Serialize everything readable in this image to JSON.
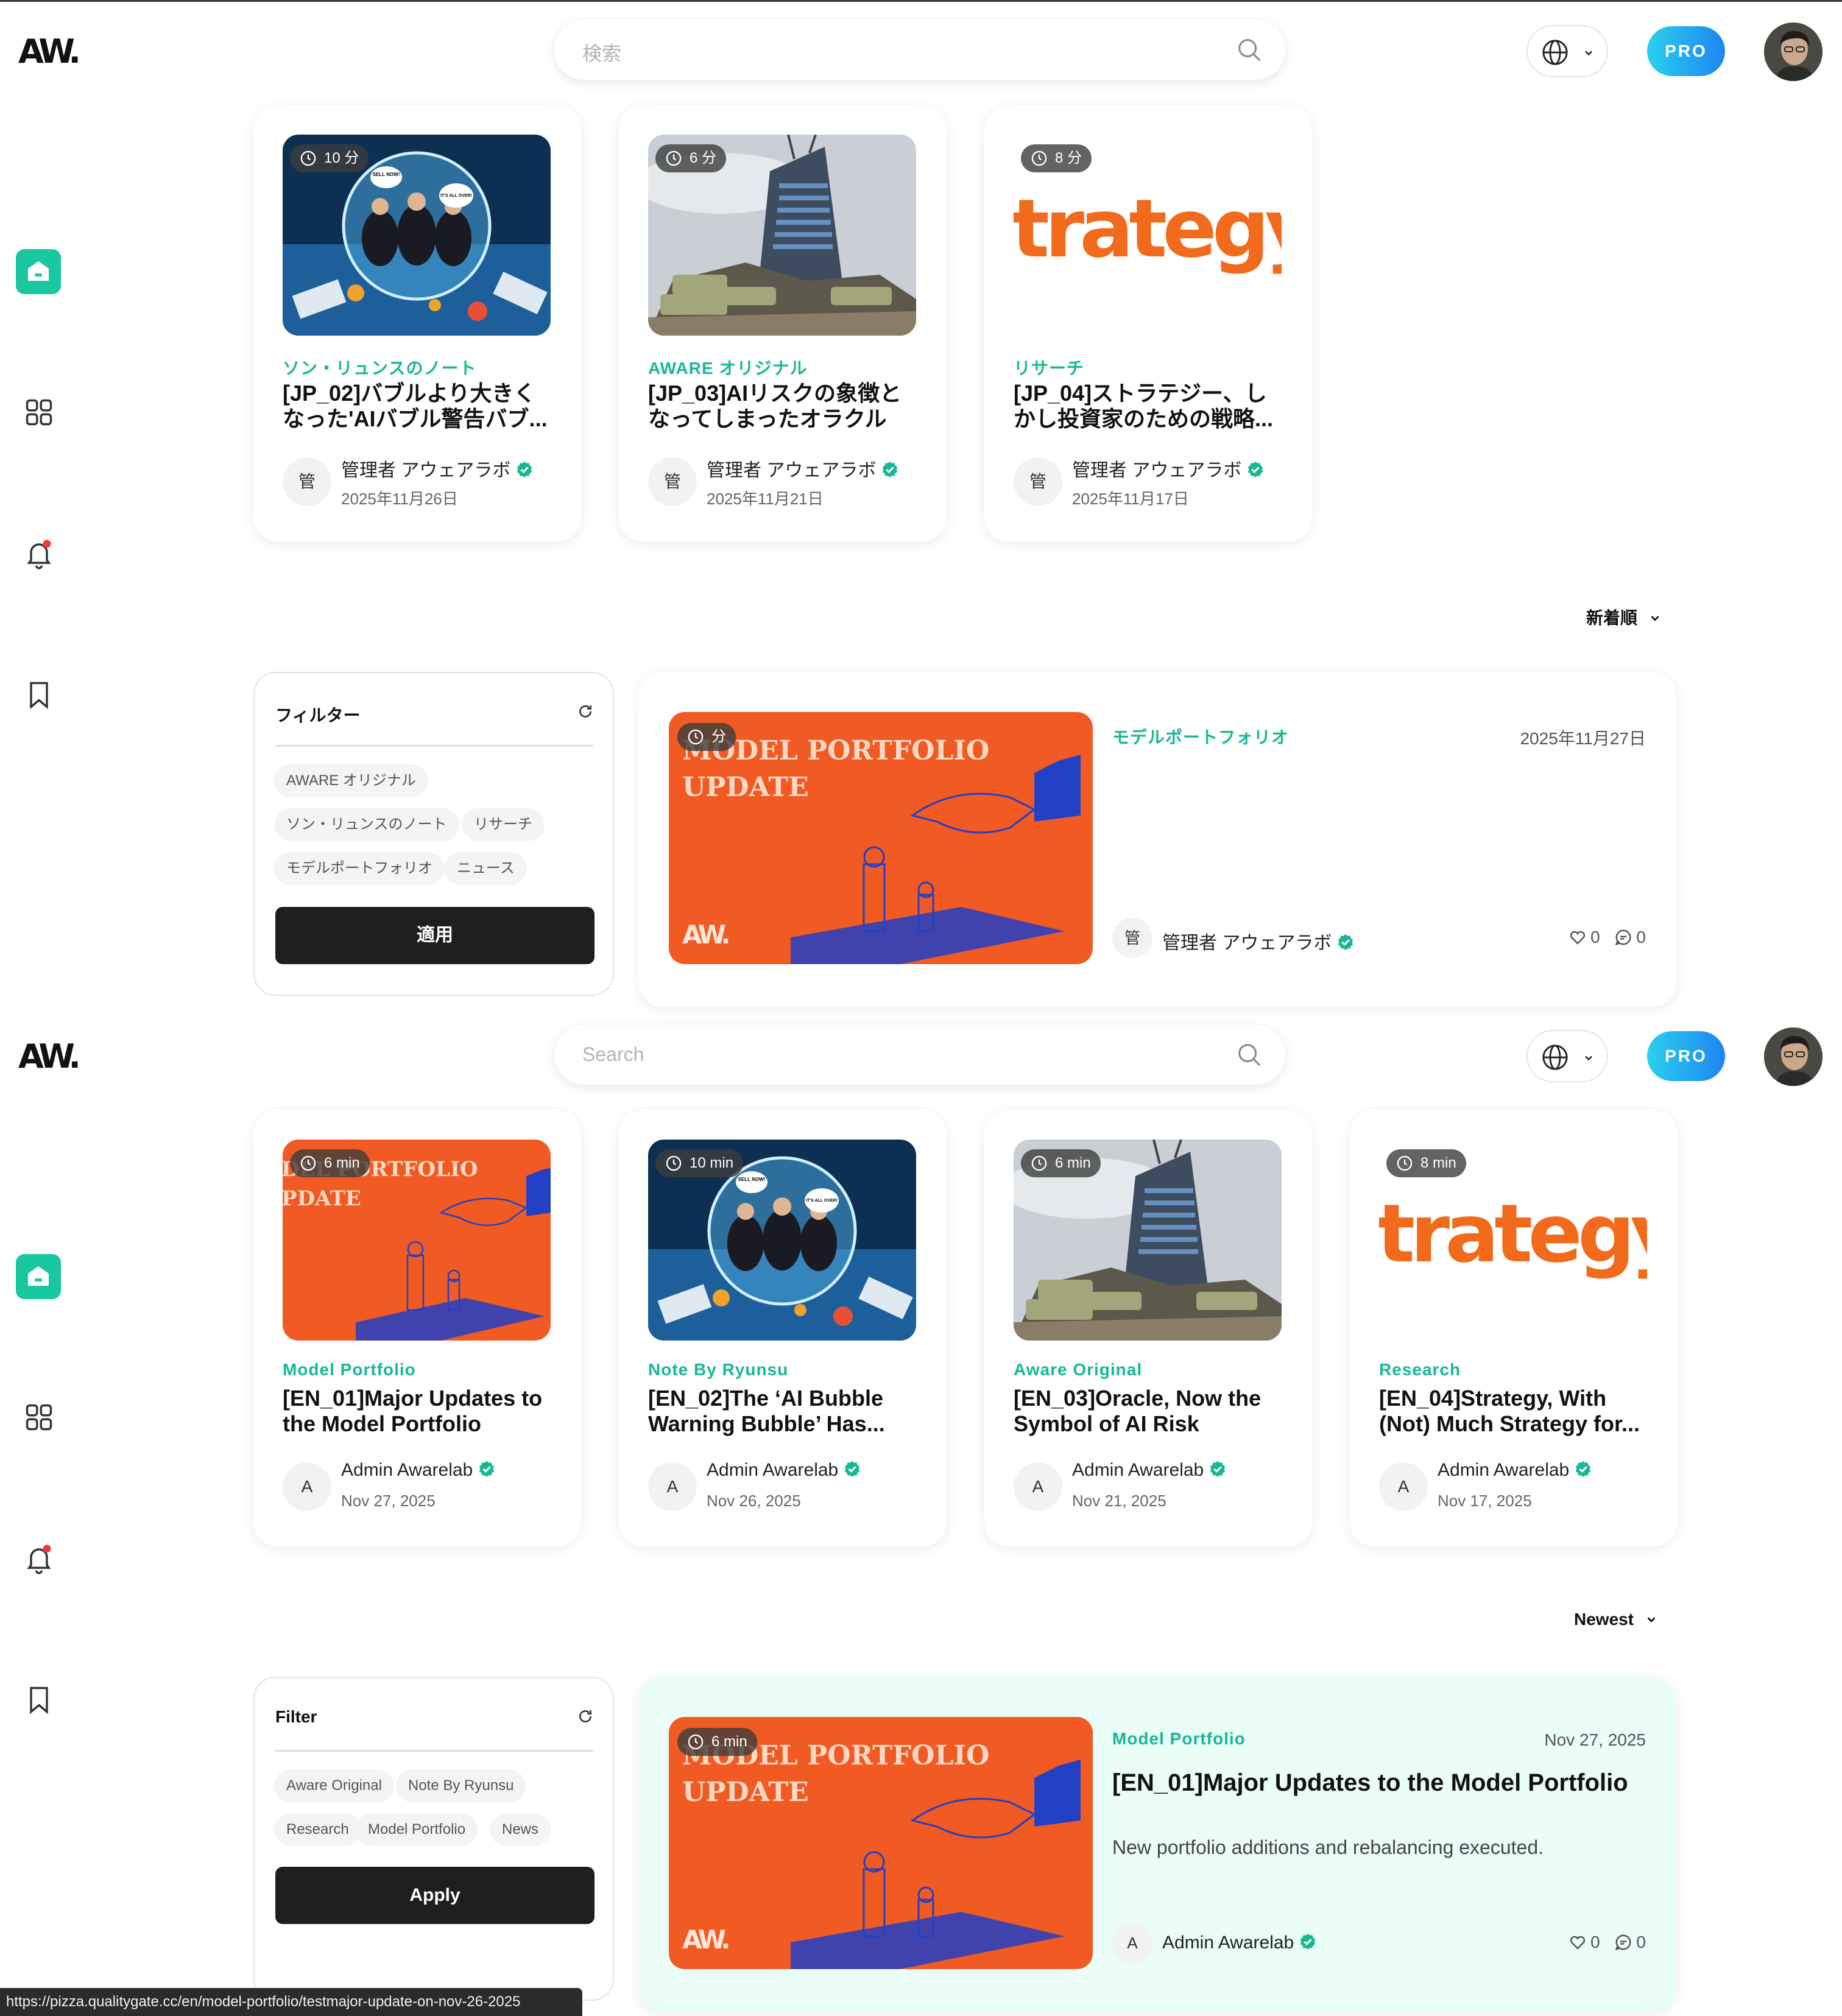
{
  "brand": {
    "logo_text": "AW",
    "logo_dot": "."
  },
  "colors": {
    "accent": "#18b895",
    "pro_gradient_start": "#2ad1ef",
    "pro_gradient_end": "#1e84f2",
    "thumb_orange": "#f15a22"
  },
  "jp": {
    "search_placeholder": "検索",
    "pro_label": "PRO",
    "cards": [
      {
        "read_time": "10 分",
        "category": "ソン・リュンスのノート",
        "title": "[JP_02]バブルより大きくなった'AIバブル警告バブ...",
        "author_initial": "管",
        "author": "管理者 アウェアラボ",
        "date": "2025年11月26日",
        "image": "bubble"
      },
      {
        "read_time": "6 分",
        "category": "AWARE オリジナル",
        "title": "[JP_03]AIリスクの象徴となってしまったオラクル",
        "author_initial": "管",
        "author": "管理者 アウェアラボ",
        "date": "2025年11月21日",
        "image": "tower"
      },
      {
        "read_time": "8 分",
        "category": "リサーチ",
        "title": "[JP_04]ストラテジー、しかし投資家のための戦略...",
        "author_initial": "管",
        "author": "管理者 アウェアラボ",
        "date": "2025年11月17日",
        "image": "strategy"
      }
    ],
    "sort_label": "新着順",
    "filter": {
      "title": "フィルター",
      "chips": [
        "AWARE オリジナル",
        "ソン・リュンスのノート",
        "リサーチ",
        "モデルポートフォリオ",
        "ニュース"
      ],
      "apply": "適用"
    },
    "featured": {
      "read_time": "分",
      "category": "モデルポートフォリオ",
      "date": "2025年11月27日",
      "title": "",
      "description": "",
      "author_initial": "管",
      "author": "管理者 アウェアラボ",
      "likes": "0",
      "comments": "0"
    }
  },
  "en": {
    "search_placeholder": "Search",
    "pro_label": "PRO",
    "cards": [
      {
        "read_time": "6 min",
        "category": "Model Portfolio",
        "title": "[EN_01]Major Updates to the Model Portfolio",
        "author_initial": "A",
        "author": "Admin Awarelab",
        "date": "Nov 27, 2025",
        "image": "portfolio"
      },
      {
        "read_time": "10 min",
        "category": "Note By Ryunsu",
        "title": "[EN_02]The ‘AI Bubble Warning Bubble’ Has...",
        "author_initial": "A",
        "author": "Admin Awarelab",
        "date": "Nov 26, 2025",
        "image": "bubble"
      },
      {
        "read_time": "6 min",
        "category": "Aware Original",
        "title": "[EN_03]Oracle, Now the Symbol of AI Risk",
        "author_initial": "A",
        "author": "Admin Awarelab",
        "date": "Nov 21, 2025",
        "image": "tower"
      },
      {
        "read_time": "8 min",
        "category": "Research",
        "title": "[EN_04]Strategy, With (Not) Much Strategy for...",
        "author_initial": "A",
        "author": "Admin Awarelab",
        "date": "Nov 17, 2025",
        "image": "strategy"
      }
    ],
    "sort_label": "Newest",
    "filter": {
      "title": "Filter",
      "chips": [
        "Aware Original",
        "Note By Ryunsu",
        "Research",
        "Model Portfolio",
        "News"
      ],
      "apply": "Apply"
    },
    "featured": {
      "read_time": "6 min",
      "category": "Model Portfolio",
      "date": "Nov 27, 2025",
      "title": "[EN_01]Major Updates to the Model Portfolio",
      "description": "New portfolio additions and rebalancing executed.",
      "author_initial": "A",
      "author": "Admin Awarelab",
      "likes": "0",
      "comments": "0"
    }
  },
  "thumb_text": {
    "portfolio_line1": "MODEL PORTFOLIO",
    "portfolio_line2": "UPDATE",
    "card_portfolio_line1": "DEL PORTFOLIO",
    "card_portfolio_line2": "PDATE",
    "strategy": "trategy",
    "bubble_sign1": "SELL NOW!",
    "bubble_sign2": "IT'S ALL OVER!",
    "logo_mark": "AW."
  },
  "status_url": "https://pizza.qualitygate.cc/en/model-portfolio/testmajor-update-on-nov-26-2025"
}
